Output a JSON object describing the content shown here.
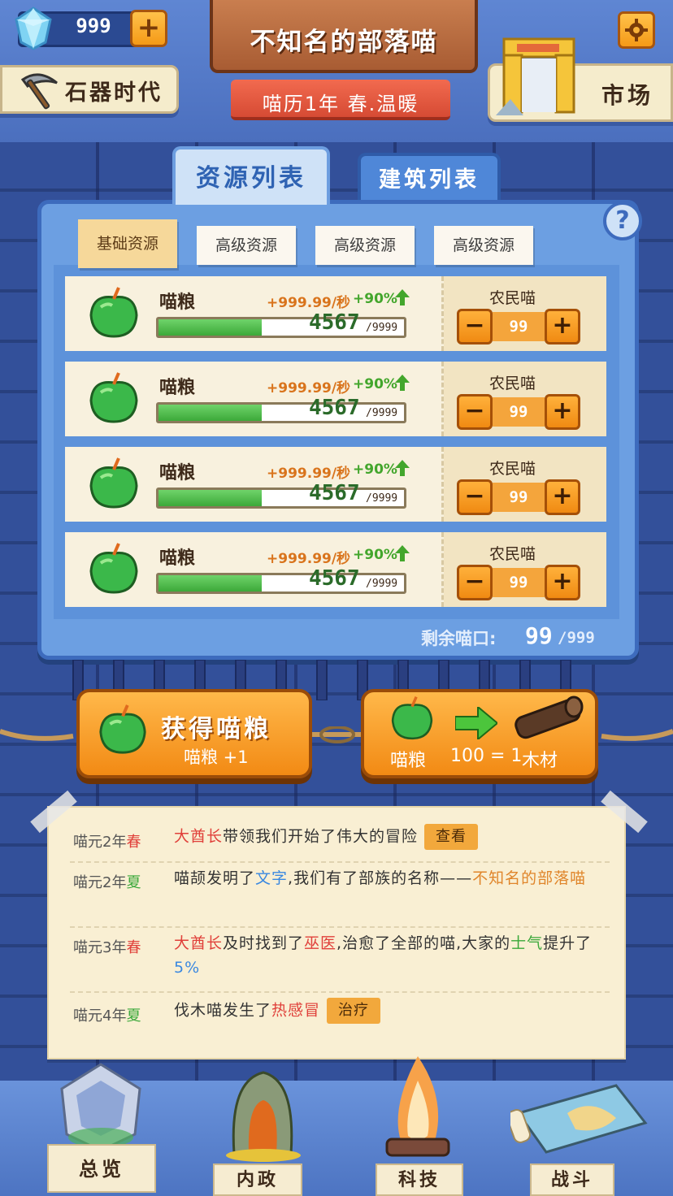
{
  "topbar": {
    "gems": "999",
    "era": "石器时代",
    "title": "不知名的部落喵",
    "date": "喵历1年 春.温暖",
    "market": "市场"
  },
  "tabs": {
    "resources": "资源列表",
    "buildings": "建筑列表"
  },
  "subtabs": [
    "基础资源",
    "高级资源",
    "高级资源",
    "高级资源"
  ],
  "resources": [
    {
      "name": "喵粮",
      "rate": "+999.99/秒",
      "bonus": "+90%",
      "current": "4567",
      "max": "/9999",
      "progress": 0.42,
      "worker_label": "农民喵",
      "workers": "99"
    },
    {
      "name": "喵粮",
      "rate": "+999.99/秒",
      "bonus": "+90%",
      "current": "4567",
      "max": "/9999",
      "progress": 0.42,
      "worker_label": "农民喵",
      "workers": "99"
    },
    {
      "name": "喵粮",
      "rate": "+999.99/秒",
      "bonus": "+90%",
      "current": "4567",
      "max": "/9999",
      "progress": 0.42,
      "worker_label": "农民喵",
      "workers": "99"
    },
    {
      "name": "喵粮",
      "rate": "+999.99/秒",
      "bonus": "+90%",
      "current": "4567",
      "max": "/9999",
      "progress": 0.42,
      "worker_label": "农民喵",
      "workers": "99"
    }
  ],
  "population": {
    "label": "剩余喵口:",
    "current": "99",
    "max": "/999"
  },
  "actions": {
    "gather_title": "获得喵粮",
    "gather_sub": "喵粮 +1",
    "convert_from": "喵粮",
    "convert_rate": "100 = 1",
    "convert_to": "木材"
  },
  "log": [
    {
      "year": "喵元2年",
      "season": "春",
      "season_color": "#e0403a",
      "parts": [
        [
          "大酋长",
          "red"
        ],
        [
          "带领我们开始了伟大的冒险",
          ""
        ]
      ],
      "button": "查看"
    },
    {
      "year": "喵元2年",
      "season": "夏",
      "season_color": "#3aa83a",
      "parts": [
        [
          "喵颉发明了",
          ""
        ],
        [
          "文字",
          "blue"
        ],
        [
          ",我们有了部族的名称——",
          ""
        ],
        [
          "不知名的部落喵",
          "orange"
        ]
      ],
      "button": ""
    },
    {
      "year": "喵元3年",
      "season": "春",
      "season_color": "#e0403a",
      "parts": [
        [
          "大酋长",
          "red"
        ],
        [
          "及时找到了",
          ""
        ],
        [
          "巫医",
          "red"
        ],
        [
          ",治愈了全部的喵,大家的",
          ""
        ],
        [
          "士气",
          "green"
        ],
        [
          "提升了",
          ""
        ],
        [
          "5%",
          "blue"
        ]
      ],
      "button": ""
    },
    {
      "year": "喵元4年",
      "season": "夏",
      "season_color": "#3aa83a",
      "parts": [
        [
          "伐木喵发生了",
          ""
        ],
        [
          "热感冒",
          "red"
        ]
      ],
      "button": "治疗"
    }
  ],
  "nav": [
    "总览",
    "内政",
    "科技",
    "战斗"
  ],
  "icons": {
    "gem": "diamond-icon",
    "pickaxe": "pickaxe-icon",
    "settings": "gear-icon",
    "market": "market-gate-icon",
    "apple": "green-apple-icon",
    "log": "wood-log-icon"
  },
  "colors": {
    "accent_orange": "#f28a14",
    "panel_blue": "#6c9fe2",
    "progress_green": "#3ca939"
  }
}
